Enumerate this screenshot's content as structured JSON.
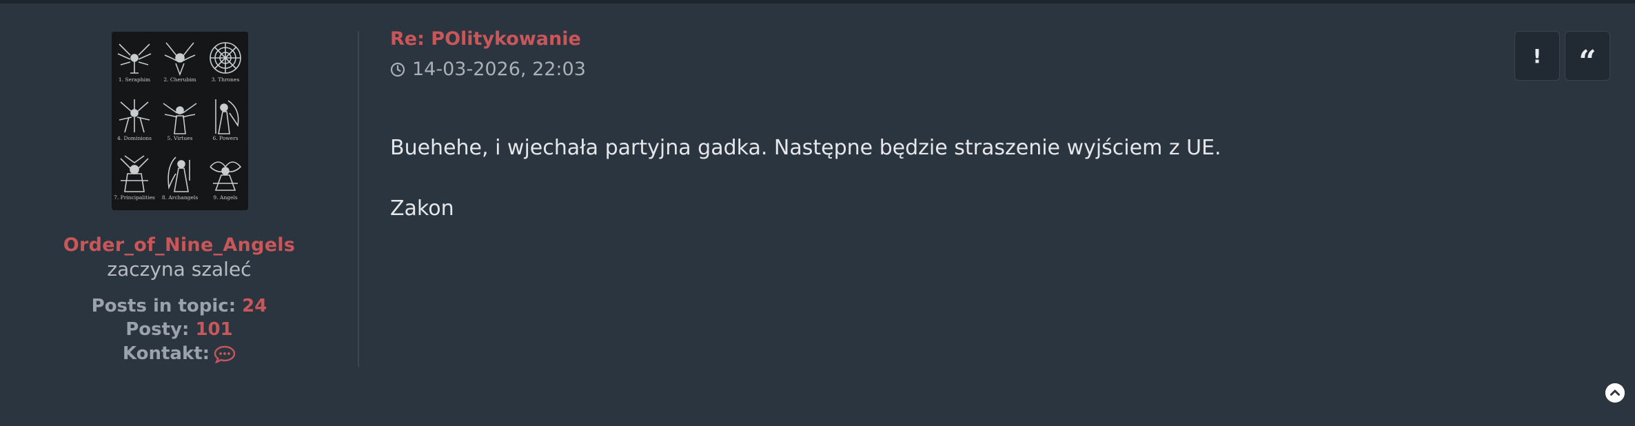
{
  "post": {
    "title": "Re: POlitykowanie",
    "datetime": "14-03-2026, 22:03",
    "body": [
      "Buehehe, i wjechała partyjna gadka. Następne będzie straszenie wyjściem z UE.",
      "Zakon"
    ]
  },
  "author": {
    "username": "Order_of_Nine_Angels",
    "rank": "zaczyna szaleć",
    "stats": {
      "posts_in_topic_label": "Posts in topic:",
      "posts_in_topic_value": "24",
      "posts_label": "Posty:",
      "posts_value": "101",
      "contact_label": "Kontakt:"
    },
    "avatar_captions": [
      "1. Seraphim",
      "2. Cherubim",
      "3. Thrones",
      "4. Dominions",
      "5. Virtues",
      "6. Powers",
      "7. Principalities",
      "8. Archangels",
      "9. Angels"
    ]
  },
  "actions": {
    "report_label": "!",
    "quote_label": "“"
  },
  "icons": {
    "clock": "clock-icon",
    "contact": "speech-bubble-icon",
    "report": "exclamation-icon",
    "quote": "quote-icon",
    "back_to_top": "chevron-up-circle-icon"
  },
  "colors": {
    "background": "#2b3540",
    "accent": "#c9575a",
    "text": "#e5e7ea",
    "muted": "#9aa3ad"
  }
}
